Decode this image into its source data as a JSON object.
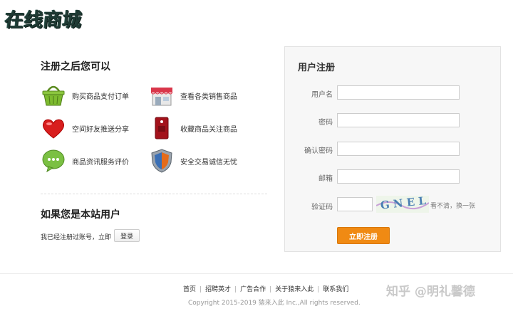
{
  "logo": {
    "text": "在线商城"
  },
  "benefits": {
    "title": "注册之后您可以",
    "items": [
      {
        "label": "购买商品支付订单",
        "icon": "shopping-basket-icon"
      },
      {
        "label": "查看各类销售商品",
        "icon": "storefront-icon"
      },
      {
        "label": "空间好友推送分享",
        "icon": "heart-icon"
      },
      {
        "label": "收藏商品关注商品",
        "icon": "bookmark-tag-icon"
      },
      {
        "label": "商品资讯服务评价",
        "icon": "speech-bubble-icon"
      },
      {
        "label": "安全交易诚信无忧",
        "icon": "shield-icon"
      }
    ]
  },
  "existing_user": {
    "title": "如果您是本站用户",
    "text": "我已经注册过账号，立即",
    "login_label": "登录"
  },
  "register": {
    "title": "用户注册",
    "fields": [
      {
        "label": "用户名"
      },
      {
        "label": "密码"
      },
      {
        "label": "确认密码"
      },
      {
        "label": "邮箱"
      },
      {
        "label": "验证码"
      }
    ],
    "captcha_text": "GNEL",
    "captcha_hint": "看不清，换一张",
    "submit_label": "立即注册"
  },
  "footer": {
    "links": [
      "首页",
      "招聘英才",
      "广告合作",
      "关于猿来入此",
      "联系我们"
    ],
    "copyright": "Copyright 2015-2019 猿来入此 Inc.,All rights reserved."
  },
  "watermark": "知乎 @明礼馨德",
  "colors": {
    "accent": "#f08a13",
    "panel_bg": "#f7f7f7",
    "logo": "#1f3a34"
  }
}
